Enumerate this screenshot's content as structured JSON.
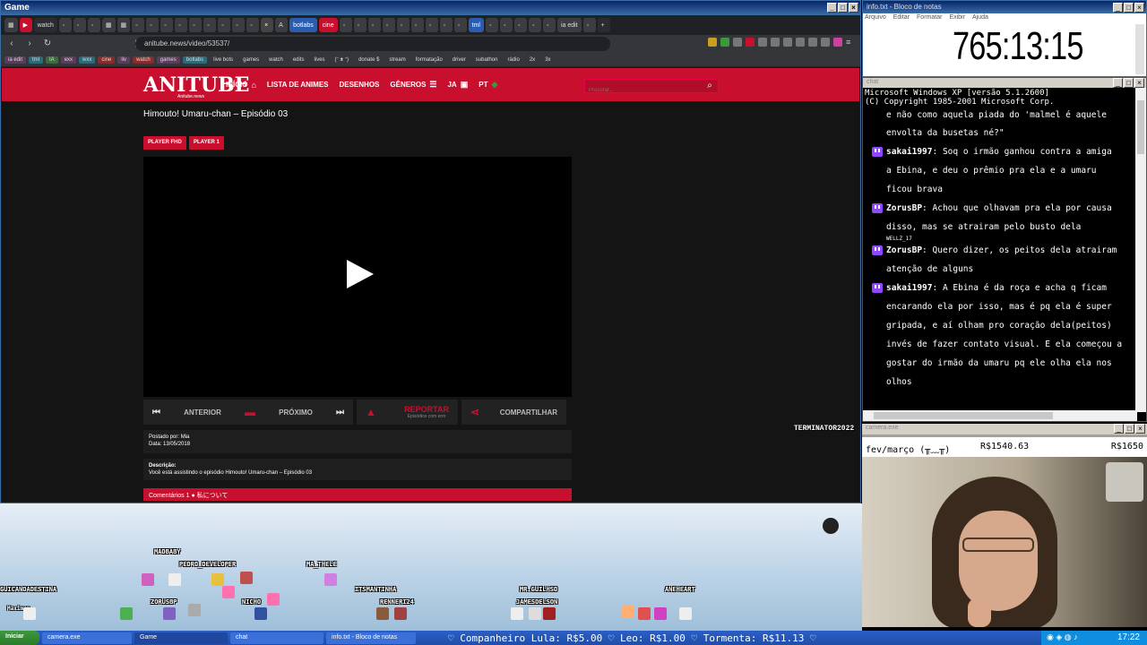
{
  "game_window": {
    "title": "Game"
  },
  "browser": {
    "tabs": [
      "watch",
      "botlabs",
      "cine",
      "tml",
      "ia edit"
    ],
    "url": "anitube.news/video/53537/",
    "bookmarks": [
      "ia edit",
      "tml",
      "IA",
      "exx",
      "wxx",
      "cine",
      "liv",
      "watch",
      "games",
      "botlabs",
      "live bots",
      "games",
      "watch",
      "edits",
      "lives",
      "(ᵔ ᴥ ᵔ)",
      "donate $",
      "stream",
      "formatação",
      "driver",
      "subathon",
      "rádio",
      "2x",
      "3x"
    ]
  },
  "site": {
    "logo": "ANITUBE",
    "logo_sub": "Anitube.news",
    "nav": [
      "INÍCIO",
      "LISTA DE ANIMES",
      "DESENHOS",
      "GÊNEROS",
      "JA",
      "PT"
    ],
    "search_placeholder": "Procurar...",
    "episode_title": "Himouto! Umaru-chan – Episódio 03",
    "player_buttons": [
      "PLAYER FHD",
      "PLAYER 1"
    ],
    "controls": {
      "previous": "ANTERIOR",
      "next": "PRÓXIMO",
      "report": "REPORTAR",
      "report_sub": "Episódios com erro",
      "share": "COMPARTILHAR"
    },
    "posted_by": "Postado por: Mia",
    "date": "Data: 13/05/2018",
    "description_label": "Descrição:",
    "description": "Você está assistindo o episódio Himouto! Umaru-chan – Episódio 03",
    "comments": "Comentários 1 ● 私について",
    "watermark": "TERMINATOR2022"
  },
  "notepad": {
    "title": "info.txt - Bloco de notas",
    "menu": [
      "Arquivo",
      "Editar",
      "Formatar",
      "Exibir",
      "Ajuda"
    ],
    "timer": "765:13:15"
  },
  "chat": {
    "title": "chat",
    "sys_lines": [
      "Microsoft Windows XP [versão 5.1.2600]",
      "(C) Copyright 1985-2001 Microsoft Corp."
    ],
    "partial_lines": [
      "e não como aquela piada do 'malmel é aquele",
      "envolta da busetas né?\""
    ],
    "messages": [
      {
        "user": "sakai1997",
        "lines": [
          "Soq o irmão ganhou contra a amiga",
          "a Ebina, e deu o prêmio pra ela e a umaru",
          "ficou brava"
        ]
      },
      {
        "user": "ZorusBP",
        "lines": [
          "Achou que olhavam pra ela por causa",
          "disso, mas se atrairam pelo busto dela"
        ]
      },
      {
        "user": "ZorusBP",
        "lines": [
          "Quero dizer, os peitos dela atrairam",
          "atenção de alguns"
        ]
      },
      {
        "user": "sakai1997",
        "lines": [
          "A Ebina é da roça e acha q ficam",
          "encarando ela por isso, mas é pq ela é super",
          "gripada, e aí olham pro coração dela(peitos)",
          "invés de fazer contato visual. E ela começou a",
          "gostar do irmão da umaru pq ele olha ela nos",
          "olhos"
        ]
      }
    ],
    "overlay_name": "WELLZ_17"
  },
  "camera": {
    "title": "camera.exe",
    "goal_label": "fev/março (╥﹏╥)",
    "goal_current": "R$1540.63",
    "goal_target": "R$1650"
  },
  "game_band": {
    "players": [
      "MADBABY",
      "PEDRO_DEVELOPER",
      "MA_THELE",
      "GUICANDADESTINA",
      "ZORUSBP",
      "NICHO",
      "ITSMANTINHA",
      "RENNERI24",
      "MR.GUILHSO",
      "JAMESDELSON",
      "ANEHEART",
      "Maximum"
    ]
  },
  "taskbar": {
    "start": "Iniciar",
    "tasks": [
      "camera.exe",
      "Game",
      "chat",
      "info.txt - Bloco de notas"
    ],
    "ticker": "♡ Companheiro Lula: R$5.00 ♡  Leo: R$1.00 ♡  Tormenta: R$11.13 ♡",
    "clock": "17:22"
  }
}
